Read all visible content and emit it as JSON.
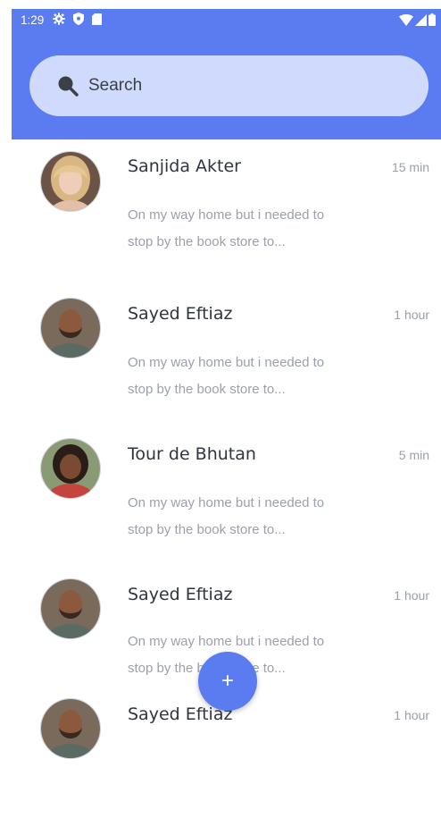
{
  "status_bar": {
    "time": "1:29",
    "left_icons": [
      "gear-icon",
      "shield-icon",
      "sim-card-icon"
    ],
    "right_icons": [
      "wifi-icon",
      "signal-icon",
      "battery-icon"
    ]
  },
  "search": {
    "placeholder": "Search"
  },
  "chats": [
    {
      "name": "Sanjida Akter",
      "time": "15 min",
      "preview_line1": "On my way home but i needed to",
      "preview_line2": "stop by the book store to...",
      "avatar": "avatar-woman-blonde"
    },
    {
      "name": "Sayed Eftiaz",
      "time": "1 hour",
      "preview_line1": "On my way home but i needed to",
      "preview_line2": "stop by the book store to...",
      "avatar": "avatar-man-bearded"
    },
    {
      "name": "Tour de Bhutan",
      "time": "5 min",
      "preview_line1": "On my way home but i needed to",
      "preview_line2": "stop by the book store to...",
      "avatar": "avatar-woman-curly"
    },
    {
      "name": "Sayed Eftiaz",
      "time": "1 hour",
      "preview_line1": "On my way home but i needed to",
      "preview_line2": "stop by the book store to...",
      "avatar": "avatar-man-bearded"
    },
    {
      "name": "Sayed Eftiaz",
      "time": "1 hour",
      "avatar": "avatar-man-bearded"
    }
  ],
  "fab": {
    "label": "+"
  },
  "colors": {
    "accent": "#5a7cf0",
    "search_bg": "#cfdafc",
    "name_text": "#2f3540",
    "secondary_text": "#9ba0ab"
  }
}
